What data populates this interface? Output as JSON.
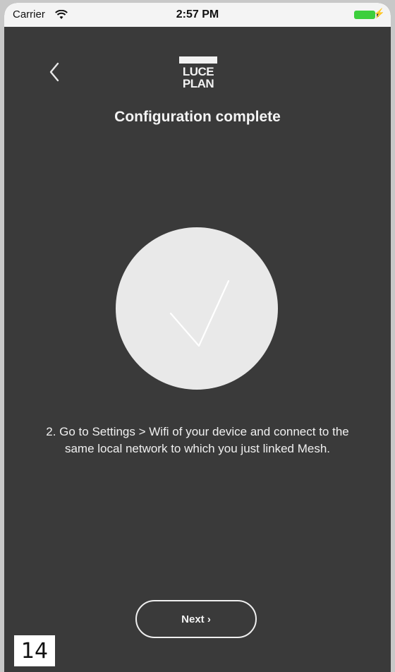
{
  "status_bar": {
    "carrier": "Carrier",
    "time": "2:57 PM",
    "battery_color": "#3ccf3c"
  },
  "header": {
    "back_icon": "chevron-left-icon",
    "logo_line1": "LUCE",
    "logo_line2": "PLAN",
    "title": "Configuration complete"
  },
  "main": {
    "status_icon": "checkmark-circle-icon",
    "message": "2. Go to Settings > Wifi of your device and connect to the same local network to which you just linked Mesh."
  },
  "footer": {
    "next_label": "Next ›"
  },
  "page_number": "14",
  "colors": {
    "background": "#3a3a3a",
    "circle": "#e9e9e9",
    "text": "#f4f4f4"
  }
}
